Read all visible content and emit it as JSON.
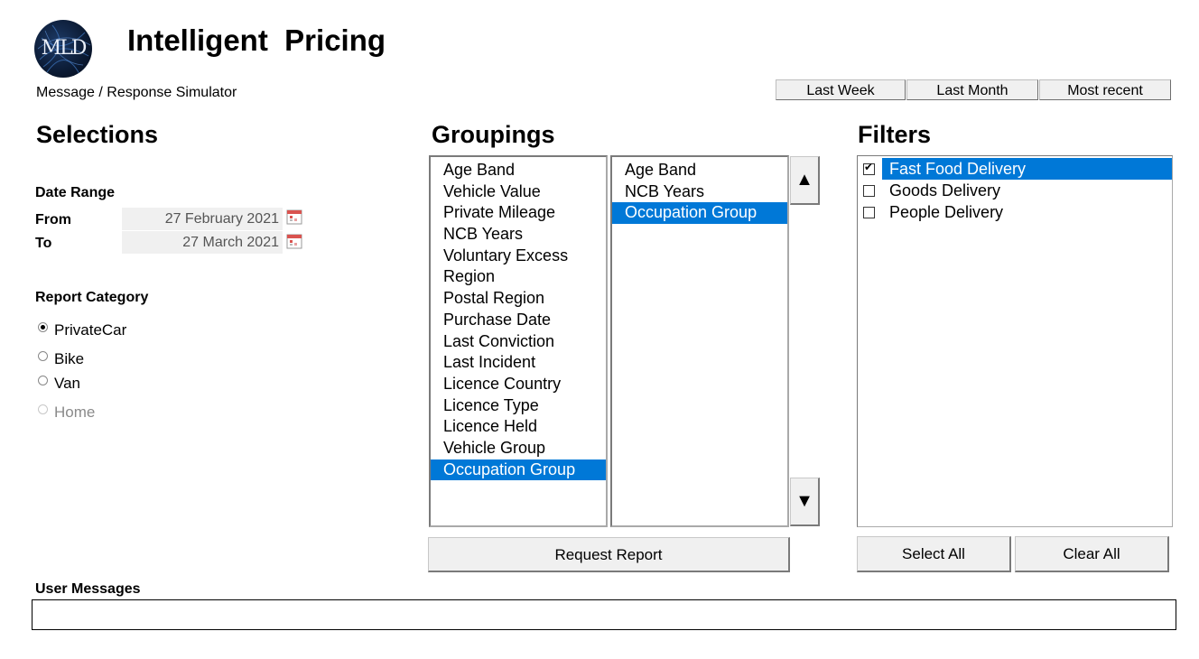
{
  "header": {
    "logo_text": "MLD",
    "title": "Intelligent  Pricing",
    "subtitle": "Message / Response Simulator"
  },
  "quick_ranges": [
    "Last Week",
    "Last Month",
    "Most recent"
  ],
  "selections": {
    "heading": "Selections",
    "date_range_label": "Date Range",
    "from_label": "From",
    "from_value": "27 February 2021",
    "to_label": "To",
    "to_value": "27 March 2021",
    "report_category_label": "Report Category",
    "categories": [
      {
        "label": "PrivateCar",
        "checked": true,
        "enabled": true
      },
      {
        "label": "Bike",
        "checked": false,
        "enabled": true
      },
      {
        "label": "Van",
        "checked": false,
        "enabled": true
      },
      {
        "label": "Home",
        "checked": false,
        "enabled": false
      }
    ]
  },
  "groupings": {
    "heading": "Groupings",
    "available": [
      "Age Band",
      "Vehicle Value",
      "Private Mileage",
      "NCB Years",
      "Voluntary Excess",
      "Region",
      "Postal Region",
      "Purchase Date",
      "Last Conviction",
      "Last Incident",
      "Licence Country",
      "Licence Type",
      "Licence Held",
      "Vehicle Group",
      "Occupation Group"
    ],
    "available_selected": "Occupation Group",
    "chosen": [
      "Age Band",
      "NCB Years",
      "Occupation Group"
    ],
    "chosen_selected": "Occupation Group",
    "up_arrow": "▲",
    "down_arrow": "▼",
    "request_button": "Request Report"
  },
  "filters": {
    "heading": "Filters",
    "items": [
      {
        "label": "Fast Food Delivery",
        "checked": true,
        "selected": true
      },
      {
        "label": "Goods Delivery",
        "checked": false,
        "selected": false
      },
      {
        "label": "People Delivery",
        "checked": false,
        "selected": false
      }
    ],
    "select_all": "Select All",
    "clear_all": "Clear All"
  },
  "messages": {
    "label": "User Messages",
    "value": ""
  },
  "colors": {
    "selection": "#0078d7",
    "button_face": "#f0f0f0"
  }
}
